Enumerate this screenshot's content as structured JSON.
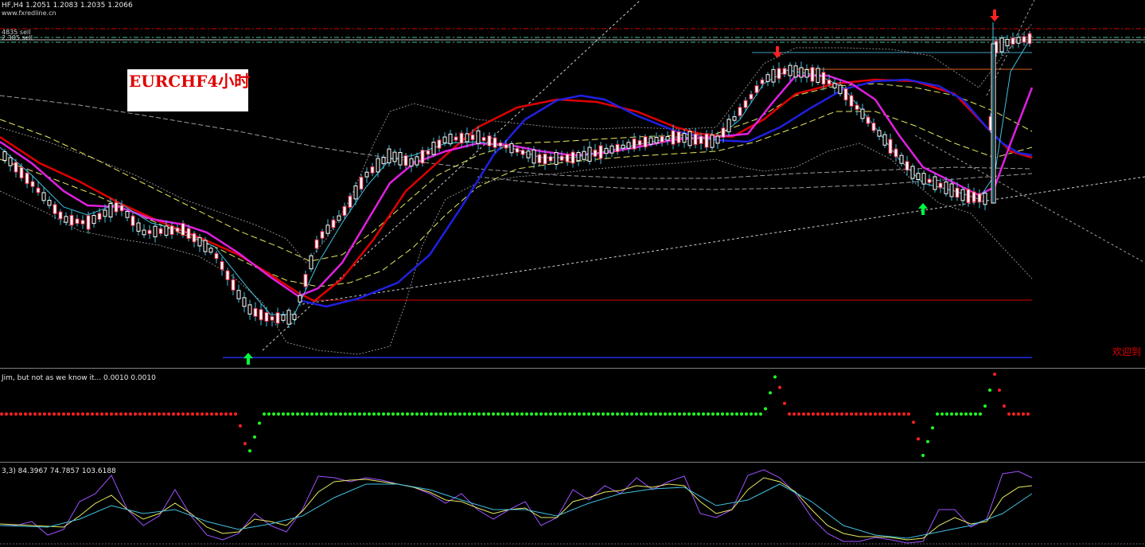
{
  "window": {
    "symbol_header": "HF,H4  1.2051 1.2083 1.2035 1.2066",
    "site": "www.fxredline.cn",
    "sell_label_1": "4835 sell",
    "sell_label_2": "2.305 sell"
  },
  "overlay": {
    "title": "EURCHF4小时",
    "welcome": "欢迎到"
  },
  "indicator1": {
    "label": "Jim, but not as we know it...  0.0010 0.0010"
  },
  "indicator2": {
    "label": "3,3) 84.3967 74.7857 103.6188"
  },
  "colors": {
    "background": "#000000",
    "bull_candle": "#ffffff",
    "bear_candle": "#ffffff",
    "ma_red": "#e00000",
    "ma_blue": "#2020e0",
    "ma_magenta": "#e020e0",
    "ma_cyan": "#40c0e0",
    "band_yellow": "#e8e860",
    "arrow_up": "#00ff40",
    "arrow_down": "#ff2020",
    "signal_red": "#ff2020",
    "signal_green": "#20ff20"
  },
  "icons": {
    "buy_arrow": "up-arrow-icon",
    "sell_arrow": "down-arrow-icon"
  }
}
